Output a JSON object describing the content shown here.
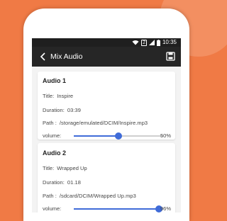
{
  "status_bar": {
    "time": "10:35",
    "sim_badge": "2",
    "icons": [
      "wifi-icon",
      "signal-icon",
      "battery-icon"
    ]
  },
  "app_bar": {
    "title": "Mix Audio",
    "back_icon": "chevron-left-icon",
    "save_icon": "save-icon"
  },
  "labels": {
    "title": "Title:",
    "duration": "Duration:",
    "path": "Path :",
    "volume": "volume:"
  },
  "audios": [
    {
      "heading": "Audio 1",
      "title": "Inspire",
      "duration": "03:39",
      "path": "/storage/emulated/DCIM/Inspire.mp3",
      "volume": 0.5,
      "volume_text": "50%"
    },
    {
      "heading": "Audio 2",
      "title": "Wrapped Up",
      "duration": "01.18",
      "path": "/sdcard/DCIM/Wrapped Up.mp3",
      "volume": 0.96,
      "volume_text": "96%"
    }
  ],
  "colors": {
    "background": "#f07a45",
    "app_bar": "#262626",
    "accent": "#3f6bd8"
  }
}
